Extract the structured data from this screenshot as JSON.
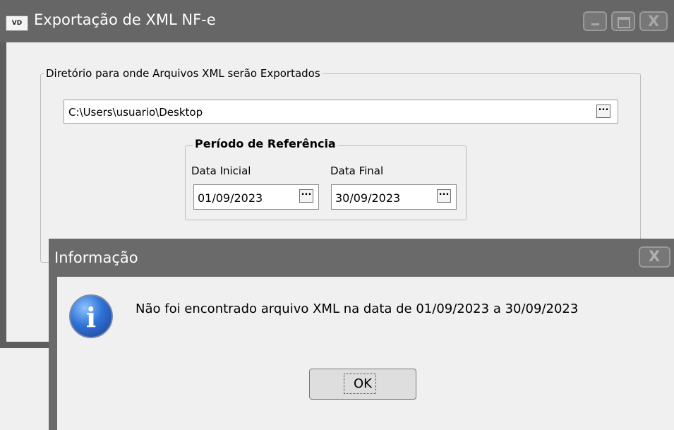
{
  "main_window": {
    "icon_text": "VD",
    "title": "Exportação de XML NF-e"
  },
  "directory_group": {
    "legend": "Diretório para onde Arquivos XML serão Exportados",
    "path_value": "C:\\Users\\usuario\\Desktop",
    "browse_label": "..."
  },
  "period_group": {
    "legend": "Período de Referência",
    "start_label": "Data Inicial",
    "start_value": "01/09/2023",
    "end_label": "Data Final",
    "end_value": "30/09/2023",
    "picker_label": "..."
  },
  "dialog": {
    "title": "Informação",
    "close_label": "X",
    "message": "Não foi encontrado arquivo XML na data de 01/09/2023 a 30/09/2023",
    "ok_label": "OK",
    "info_glyph": "i"
  },
  "window_controls": {
    "close_label": "X"
  }
}
